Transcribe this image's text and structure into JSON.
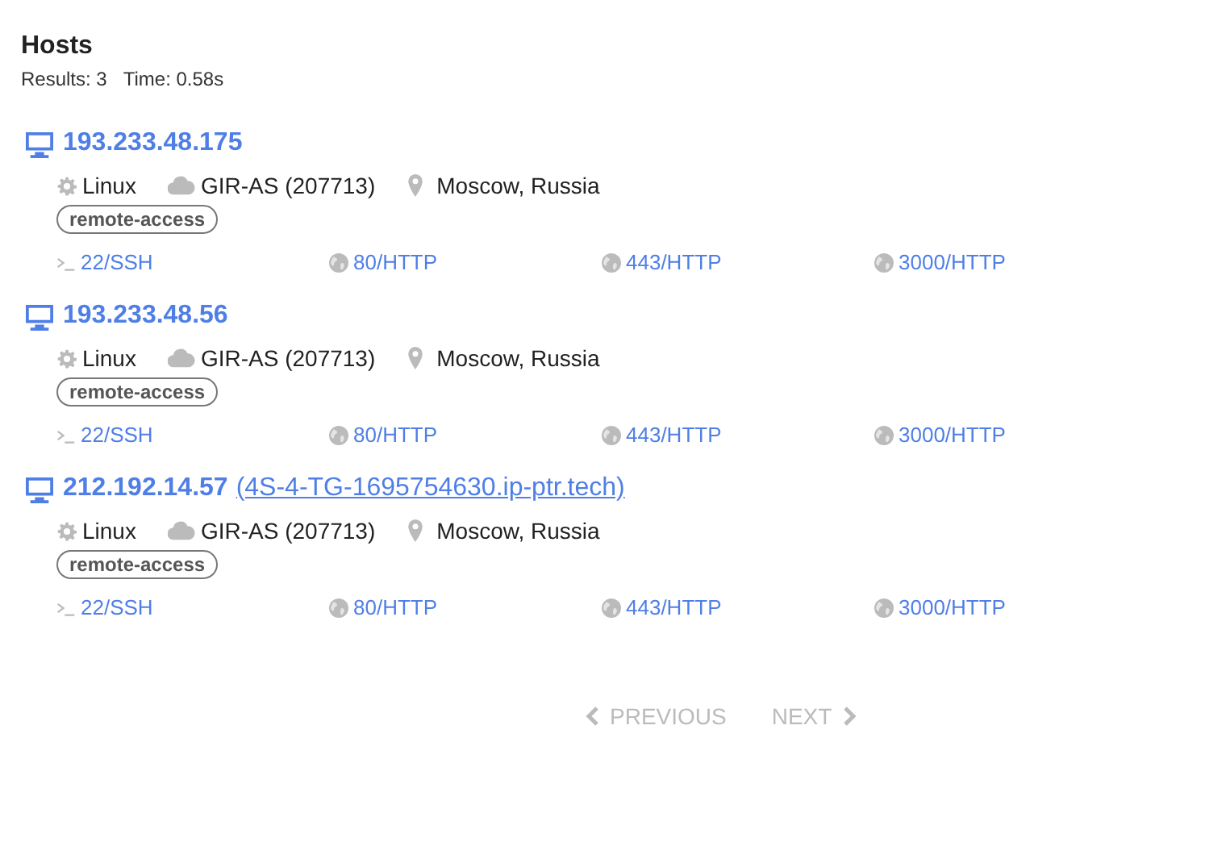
{
  "title": "Hosts",
  "summary": {
    "results": "Results: 3",
    "time": "Time: 0.58s"
  },
  "hosts": [
    {
      "ip": "193.233.48.175",
      "os": "Linux",
      "asn": "GIR-AS (207713)",
      "location": "Moscow, Russia",
      "tags": [
        "remote-access"
      ],
      "ports": [
        {
          "kind": "ssh",
          "label": "22/SSH"
        },
        {
          "kind": "http",
          "label": "80/HTTP"
        },
        {
          "kind": "http",
          "label": "443/HTTP"
        },
        {
          "kind": "http",
          "label": "3000/HTTP"
        }
      ]
    },
    {
      "ip": "193.233.48.56",
      "os": "Linux",
      "asn": "GIR-AS (207713)",
      "location": "Moscow, Russia",
      "tags": [
        "remote-access"
      ],
      "ports": [
        {
          "kind": "ssh",
          "label": "22/SSH"
        },
        {
          "kind": "http",
          "label": "80/HTTP"
        },
        {
          "kind": "http",
          "label": "443/HTTP"
        },
        {
          "kind": "http",
          "label": "3000/HTTP"
        }
      ]
    },
    {
      "ip": "212.192.14.57",
      "hostname": "(4S-4-TG-1695754630.ip-ptr.tech)",
      "os": "Linux",
      "asn": "GIR-AS (207713)",
      "location": "Moscow, Russia",
      "tags": [
        "remote-access"
      ],
      "ports": [
        {
          "kind": "ssh",
          "label": "22/SSH"
        },
        {
          "kind": "http",
          "label": "80/HTTP"
        },
        {
          "kind": "http",
          "label": "443/HTTP"
        },
        {
          "kind": "http",
          "label": "3000/HTTP"
        }
      ]
    }
  ],
  "pagination": {
    "previous": {
      "label": "PREVIOUS",
      "disabled": true
    },
    "next": {
      "label": "NEXT",
      "disabled": true
    }
  }
}
